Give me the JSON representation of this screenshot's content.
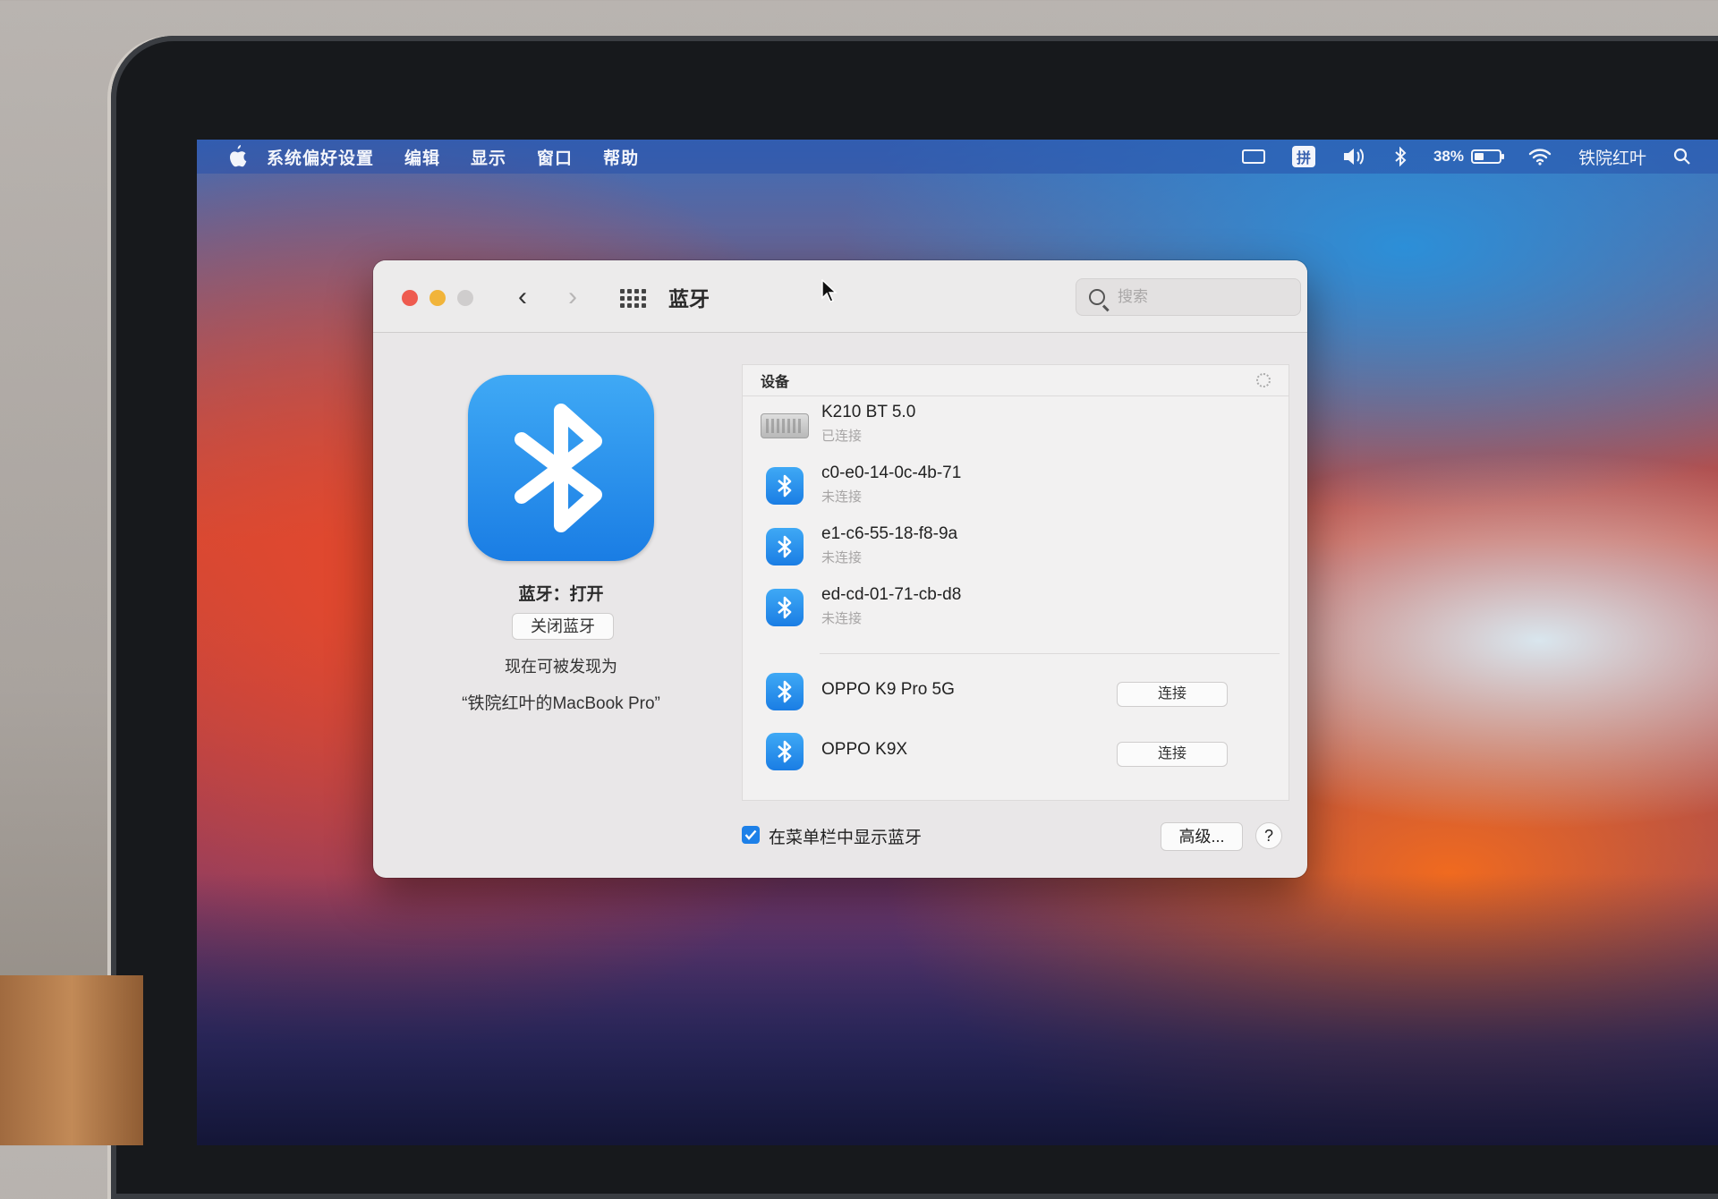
{
  "menubar": {
    "app_name": "系统偏好设置",
    "menus": [
      "编辑",
      "显示",
      "窗口",
      "帮助"
    ],
    "pinyin_label": "拼",
    "battery_percent": "38%",
    "battery_level": 0.38,
    "user_name": "铁院红叶",
    "icons": [
      "apple-icon",
      "keyboard-icon",
      "input-method-icon",
      "volume-icon",
      "bluetooth-icon",
      "battery-icon",
      "wifi-icon",
      "search-icon"
    ]
  },
  "window": {
    "title": "蓝牙",
    "search_placeholder": "搜索",
    "status": "蓝牙：打开",
    "toggle_button": "关闭蓝牙",
    "discoverable_label": "现在可被发现为",
    "device_name": "“铁院红叶的MacBook Pro”",
    "list_header": "设备",
    "devices": [
      {
        "name": "K210 BT 5.0",
        "status": "已连接",
        "icon": "keyboard-icon"
      },
      {
        "name": "c0-e0-14-0c-4b-71",
        "status": "未连接",
        "icon": "bluetooth-icon"
      },
      {
        "name": "e1-c6-55-18-f8-9a",
        "status": "未连接",
        "icon": "bluetooth-icon"
      },
      {
        "name": "ed-cd-01-71-cb-d8",
        "status": "未连接",
        "icon": "bluetooth-icon"
      }
    ],
    "nearby_devices": [
      {
        "name": "OPPO K9 Pro 5G",
        "action": "连接",
        "icon": "bluetooth-icon"
      },
      {
        "name": "OPPO K9X",
        "action": "连接",
        "icon": "bluetooth-icon"
      }
    ],
    "show_in_menubar_label": "在菜单栏中显示蓝牙",
    "show_in_menubar_checked": true,
    "advanced_button": "高级...",
    "help_button": "?"
  },
  "colors": {
    "accent": "#1d80e8",
    "close": "#ee5b4f",
    "minimize": "#f1b43a"
  }
}
